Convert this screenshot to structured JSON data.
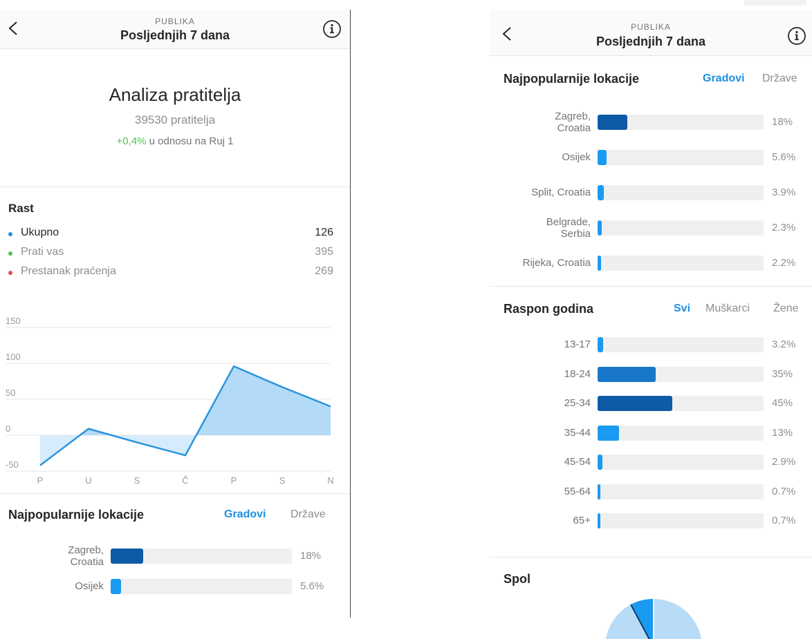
{
  "left_screen": {
    "header": {
      "subtitle": "PUBLIKA",
      "title": "Posljednjih 7 dana"
    },
    "analysis": {
      "title": "Analiza pratitelja",
      "followers": "39530 pratitelja",
      "change_value": "+0,4%",
      "change_text": " u odnosu na Ruj 1"
    },
    "growth": {
      "title": "Rast",
      "legend": [
        {
          "name": "Ukupno",
          "value": "126",
          "color": "#1a8fe3"
        },
        {
          "name": "Prati vas",
          "value": "395",
          "color": "#4fc34f"
        },
        {
          "name": "Prestanak praćenja",
          "value": "269",
          "color": "#ed4956"
        }
      ]
    },
    "locations": {
      "title": "Najpopularnije lokacije",
      "tabs": [
        "Gradovi",
        "Države"
      ],
      "bars": [
        {
          "label": [
            "Zagreb,",
            "Croatia"
          ],
          "pct_text": "18%",
          "value": 18
        },
        {
          "label": [
            "Osijek"
          ],
          "pct_text": "5.6%",
          "value": 5.6
        }
      ]
    }
  },
  "right_screen": {
    "header": {
      "subtitle": "PUBLIKA",
      "title": "Posljednjih 7 dana"
    },
    "locations": {
      "title": "Najpopularnije lokacije",
      "tabs": [
        "Gradovi",
        "Države"
      ],
      "bars": [
        {
          "label": [
            "Zagreb,",
            "Croatia"
          ],
          "pct_text": "18%",
          "value": 18
        },
        {
          "label": [
            "Osijek"
          ],
          "pct_text": "5.6%",
          "value": 5.6
        },
        {
          "label": [
            "Split, Croatia"
          ],
          "pct_text": "3.9%",
          "value": 3.9
        },
        {
          "label": [
            "Belgrade,",
            "Serbia"
          ],
          "pct_text": "2.3%",
          "value": 2.3
        },
        {
          "label": [
            "Rijeka, Croatia"
          ],
          "pct_text": "2.2%",
          "value": 2.2
        }
      ]
    },
    "age": {
      "title": "Raspon godina",
      "tabs": [
        "Svi",
        "Muškarci",
        "Žene"
      ],
      "bars": [
        {
          "label": [
            "13-17"
          ],
          "pct_text": "3.2%",
          "value": 3.2
        },
        {
          "label": [
            "18-24"
          ],
          "pct_text": "35%",
          "value": 35
        },
        {
          "label": [
            "25-34"
          ],
          "pct_text": "45%",
          "value": 45
        },
        {
          "label": [
            "35-44"
          ],
          "pct_text": "13%",
          "value": 13
        },
        {
          "label": [
            "45-54"
          ],
          "pct_text": "2.9%",
          "value": 2.9
        },
        {
          "label": [
            "55-64"
          ],
          "pct_text": "0.7%",
          "value": 0.7
        },
        {
          "label": [
            "65+"
          ],
          "pct_text": "0.7%",
          "value": 0.7
        }
      ]
    },
    "gender": {
      "title": "Spol"
    }
  },
  "colors": {
    "accent": "#1a8fe3",
    "bar_dark": "#0e5aa6",
    "bar_mid": "#1877c9",
    "bar_light": "#1a9af0",
    "positive": "#4fc34f"
  },
  "chart_data": {
    "type": "area",
    "categories": [
      "P",
      "U",
      "S",
      "Č",
      "P",
      "S",
      "N"
    ],
    "series": [
      {
        "name": "Ukupno",
        "values": [
          -42,
          9,
          -10,
          -28,
          96,
          67,
          40
        ]
      }
    ],
    "yticks": [
      "150",
      "100",
      "50",
      "0",
      "-50"
    ],
    "ylim": [
      -50,
      150
    ],
    "grid": true
  }
}
